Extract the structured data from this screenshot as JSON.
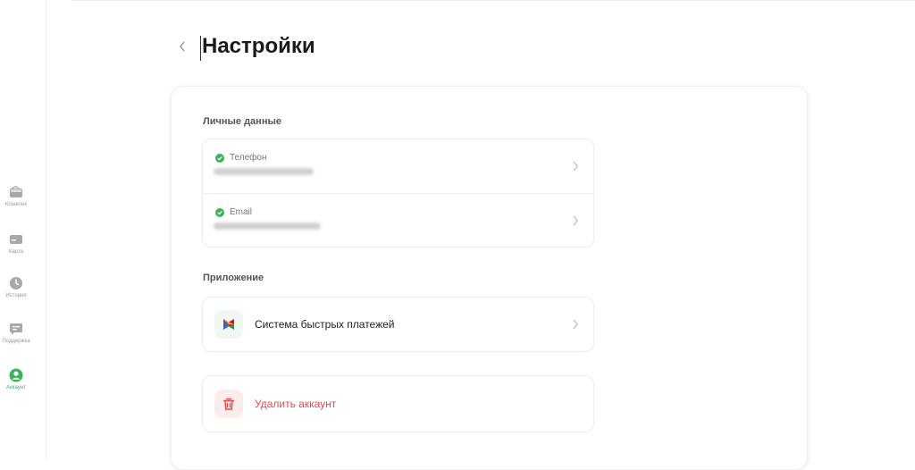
{
  "colors": {
    "accent": "#3cb35b",
    "danger": "#e5484d",
    "muted": "#9a9a9a"
  },
  "sidebar": {
    "items": [
      {
        "label": "Кошелек",
        "icon": "wallet-icon",
        "active": false
      },
      {
        "label": "Карта",
        "icon": "card-icon",
        "active": false
      },
      {
        "label": "История",
        "icon": "clock-icon",
        "active": false
      },
      {
        "label": "Поддержка",
        "icon": "chat-icon",
        "active": false
      },
      {
        "label": "Аккаунт",
        "icon": "user-icon",
        "active": true
      }
    ]
  },
  "header": {
    "title": "Настройки"
  },
  "personal": {
    "section_title": "Личные данные",
    "phone_label": "Телефон",
    "email_label": "Email"
  },
  "app": {
    "section_title": "Приложение",
    "sbp_label": "Система быстрых платежей",
    "delete_label": "Удалить аккаунт"
  }
}
